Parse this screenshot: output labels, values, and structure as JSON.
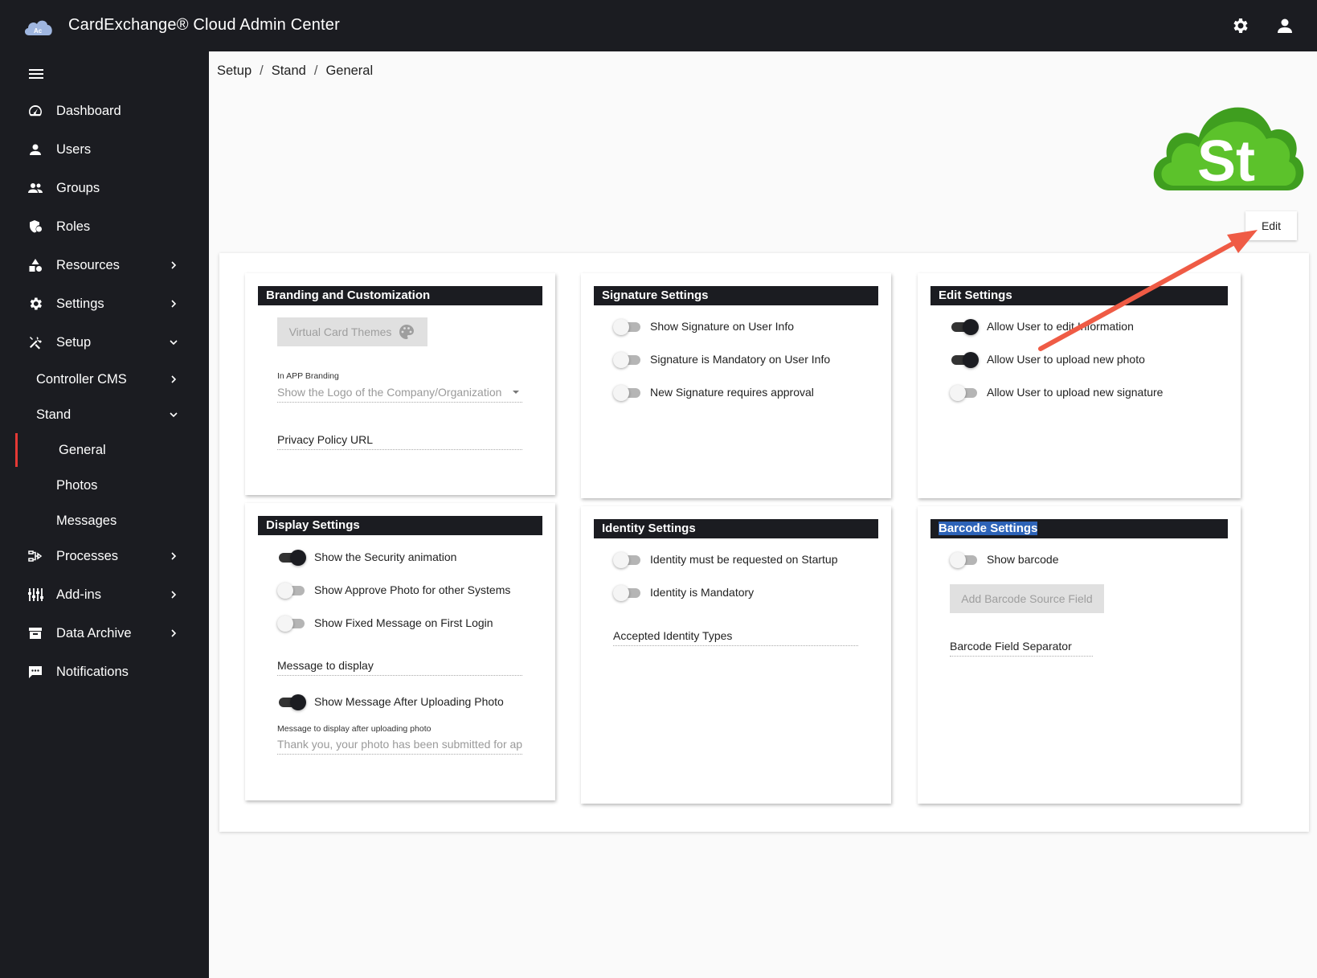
{
  "app": {
    "title": "CardExchange® Cloud Admin Center"
  },
  "header": {
    "settings_icon": "gear-icon",
    "user_icon": "account-icon"
  },
  "sidebar": {
    "items": [
      {
        "label": "Dashboard",
        "icon": "speedometer-icon"
      },
      {
        "label": "Users",
        "icon": "person-icon"
      },
      {
        "label": "Groups",
        "icon": "people-icon"
      },
      {
        "label": "Roles",
        "icon": "shield-icon"
      },
      {
        "label": "Resources",
        "icon": "shapes-icon"
      },
      {
        "label": "Settings",
        "icon": "gear-icon"
      },
      {
        "label": "Setup",
        "icon": "tools-icon"
      },
      {
        "label": "Controller CMS"
      },
      {
        "label": "Stand"
      },
      {
        "label": "General"
      },
      {
        "label": "Photos"
      },
      {
        "label": "Messages"
      },
      {
        "label": "Processes",
        "icon": "process-icon"
      },
      {
        "label": "Add-ins",
        "icon": "sliders-icon"
      },
      {
        "label": "Data Archive",
        "icon": "archive-icon"
      },
      {
        "label": "Notifications",
        "icon": "message-icon"
      }
    ]
  },
  "breadcrumb": {
    "items": [
      "Setup",
      "Stand",
      "General"
    ],
    "separator": "/"
  },
  "page": {
    "edit_label": "Edit",
    "logo_text": "St"
  },
  "branding": {
    "title": "Branding and Customization",
    "themes_button": "Virtual Card Themes",
    "in_app_label": "In APP Branding",
    "in_app_value": "Show the Logo of the Company/Organization",
    "privacy_label": "Privacy Policy URL"
  },
  "signature": {
    "title": "Signature Settings",
    "toggles": [
      {
        "label": "Show Signature on User Info",
        "on": false
      },
      {
        "label": "Signature is Mandatory on User Info",
        "on": false
      },
      {
        "label": "New Signature requires approval",
        "on": false
      }
    ]
  },
  "edit_settings": {
    "title": "Edit Settings",
    "toggles": [
      {
        "label": "Allow User to edit Information",
        "on": true
      },
      {
        "label": "Allow User to upload new photo",
        "on": true
      },
      {
        "label": "Allow User to upload new signature",
        "on": false
      }
    ]
  },
  "display": {
    "title": "Display Settings",
    "toggles": [
      {
        "label": "Show the Security animation",
        "on": true
      },
      {
        "label": "Show Approve Photo for other Systems",
        "on": false
      },
      {
        "label": "Show Fixed Message on First Login",
        "on": false
      }
    ],
    "message_label": "Message to display",
    "after_upload_toggle": {
      "label": "Show Message After Uploading Photo",
      "on": true
    },
    "after_upload_label": "Message to display after uploading photo",
    "after_upload_value": "Thank you, your photo has been submitted for ap"
  },
  "identity": {
    "title": "Identity Settings",
    "toggles": [
      {
        "label": "Identity must be requested on Startup",
        "on": false
      },
      {
        "label": "Identity is Mandatory",
        "on": false
      }
    ],
    "accepted_label": "Accepted Identity Types"
  },
  "barcode": {
    "title": "Barcode Settings",
    "toggles": [
      {
        "label": "Show barcode",
        "on": false
      }
    ],
    "add_button": "Add Barcode Source Field",
    "separator_label": "Barcode Field Separator"
  },
  "colors": {
    "dark": "#1b1c21",
    "accent": "#e53935",
    "logo_green": "#4caf27",
    "selection": "#2d63b8"
  }
}
